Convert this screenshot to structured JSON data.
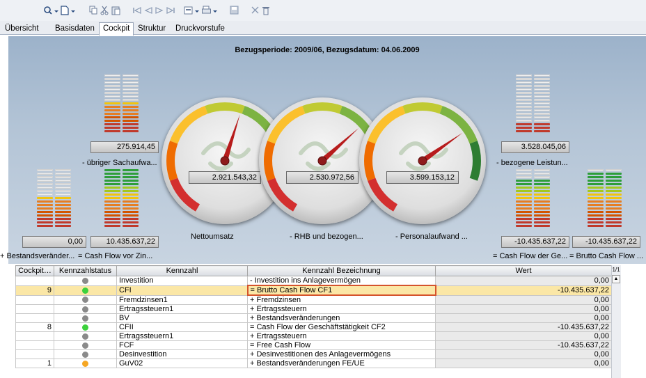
{
  "toolbar": {
    "icons": [
      "search-dropdown-icon",
      "new-document-icon",
      "copy-icon",
      "cut-icon",
      "paste-icon",
      "first-record-icon",
      "previous-record-icon",
      "next-record-icon",
      "last-record-icon",
      "print-dropdown-icon",
      "print-preview-dropdown-icon",
      "save-icon",
      "close-icon",
      "delete-icon"
    ]
  },
  "tabs": [
    {
      "label": "Übersicht"
    },
    {
      "label": "Basisdaten"
    },
    {
      "label": "Cockpit",
      "active": true
    },
    {
      "label": "Struktur"
    },
    {
      "label": "Druckvorstufe"
    }
  ],
  "cockpit": {
    "header": "Bezugsperiode: 2009/06, Bezugsdatum: 04.06.2009",
    "indicators": [
      {
        "value": "275.914,45",
        "label": "- übriger Sachaufwa...",
        "level": 0.55
      },
      {
        "value": "0,00",
        "label": "+ Bestandsveränder...",
        "level": 0.5
      },
      {
        "value": "10.435.637,22",
        "label": "= Cash Flow vor Zin...",
        "level": 1.0
      },
      {
        "value": "3.528.045,06",
        "label": "- bezogene Leistun...",
        "level": 0.15
      },
      {
        "value": "-10.435.637,22",
        "label": "= Cash Flow der Ge...",
        "level": 0.8
      },
      {
        "value": "-10.435.637,22",
        "label": "= Brutto Cash Flow ...",
        "level": 0.95
      }
    ],
    "gauges": [
      {
        "value": "2.921.543,32",
        "label": "Nettoumsatz",
        "angle": 18
      },
      {
        "value": "2.530.972,56",
        "label": "- RHB und bezogen...",
        "angle": 48
      },
      {
        "value": "3.599.153,12",
        "label": "- Personalaufwand ...",
        "angle": 55
      }
    ]
  },
  "grid": {
    "columns": [
      "Cockpit…",
      "Kennzahlstatus",
      "Kennzahl",
      "Kennzahl Bezeichnung",
      "Wert"
    ],
    "page": "1/1",
    "status_colors": {
      "grey": "#8a8a8a",
      "green": "#3dd13d",
      "orange": "#f5a623"
    },
    "rows": [
      {
        "cockpit": "",
        "status": "grey",
        "kennzahl": "Investition",
        "bezeichnung": "- Investition ins Anlagevermögen",
        "wert": "0,00"
      },
      {
        "cockpit": "9",
        "status": "green",
        "kennzahl": "CFI",
        "bezeichnung": "= Brutto Cash Flow CF1",
        "wert": "-10.435.637,22",
        "selected": true
      },
      {
        "cockpit": "",
        "status": "grey",
        "kennzahl": "Fremdzinsen1",
        "bezeichnung": "+ Fremdzinsen",
        "wert": "0,00"
      },
      {
        "cockpit": "",
        "status": "grey",
        "kennzahl": "Ertragssteuern1",
        "bezeichnung": "+ Ertragssteuern",
        "wert": "0,00"
      },
      {
        "cockpit": "",
        "status": "grey",
        "kennzahl": "BV",
        "bezeichnung": "+ Bestandsveränderungen",
        "wert": "0,00"
      },
      {
        "cockpit": "8",
        "status": "green",
        "kennzahl": "CFII",
        "bezeichnung": "= Cash Flow der Geschäftstätigkeit CF2",
        "wert": "-10.435.637,22"
      },
      {
        "cockpit": "",
        "status": "grey",
        "kennzahl": "Ertragssteuern1",
        "bezeichnung": "+ Ertragssteuern",
        "wert": "0,00"
      },
      {
        "cockpit": "",
        "status": "grey",
        "kennzahl": "FCF",
        "bezeichnung": "= Free Cash Flow",
        "wert": "-10.435.637,22"
      },
      {
        "cockpit": "",
        "status": "grey",
        "kennzahl": "Desinvestition",
        "bezeichnung": "+ Desinvestitionen des Anlagevermögens",
        "wert": "0,00"
      },
      {
        "cockpit": "1",
        "status": "orange",
        "kennzahl": "GuV02",
        "bezeichnung": "+ Bestandsveränderungen FE/UE",
        "wert": "0,00"
      }
    ]
  }
}
